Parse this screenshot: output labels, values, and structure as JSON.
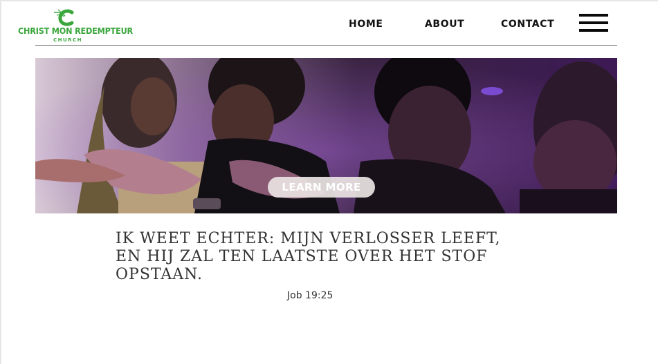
{
  "brand": {
    "name": "CHRIST MON REDEMPTEUR",
    "tagline": "CHURCH",
    "logo_icon": "leaf-c-icon",
    "color": "#3aa63c"
  },
  "nav": {
    "items": [
      {
        "label": "HOME"
      },
      {
        "label": "ABOUT"
      },
      {
        "label": "CONTACT"
      }
    ],
    "menu_icon": "hamburger-menu-icon"
  },
  "hero": {
    "image_subject": "people praying with hands together in purple light",
    "cta_label": "LEARN MORE"
  },
  "scripture": {
    "quote": "Ik weet echter: mijn Verlosser leeft, en Hij zal ten laatste over het stof opstaan.",
    "reference": "Job 19:25"
  }
}
